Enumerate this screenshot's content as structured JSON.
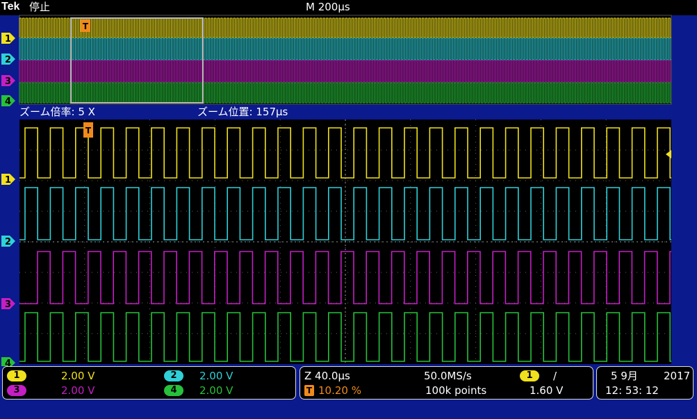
{
  "header": {
    "brand": "Tek",
    "state": "停止",
    "timebase": "M 200µs"
  },
  "zoom": {
    "factor_label": "ズーム倍率: 5 X",
    "position_label": "ズーム位置: 157µs"
  },
  "channels": [
    {
      "id": "1",
      "color": "#f0e11e",
      "scale": "2.00 V"
    },
    {
      "id": "2",
      "color": "#2fd0d8",
      "scale": "2.00 V"
    },
    {
      "id": "3",
      "color": "#c31fc3",
      "scale": "2.00 V"
    },
    {
      "id": "4",
      "color": "#27c13b",
      "scale": "2.00 V"
    }
  ],
  "horizontal": {
    "zoom_scale": "Z 40.0µs",
    "trigger_position": "10.20 %",
    "sample_rate": "50.0MS/s",
    "record_length": "100k points",
    "trigger_source": "1",
    "trigger_slope": "/",
    "trigger_level": "1.60 V"
  },
  "datetime": {
    "date": "5 9月",
    "year": "2017",
    "time": "12: 53: 12"
  },
  "markers": {
    "trigger": "T"
  },
  "colors": {
    "trigger": "#f08a1c",
    "screen_bg": "#000000",
    "frame_bg": "#0b1a8c",
    "grid": "#888888"
  }
}
